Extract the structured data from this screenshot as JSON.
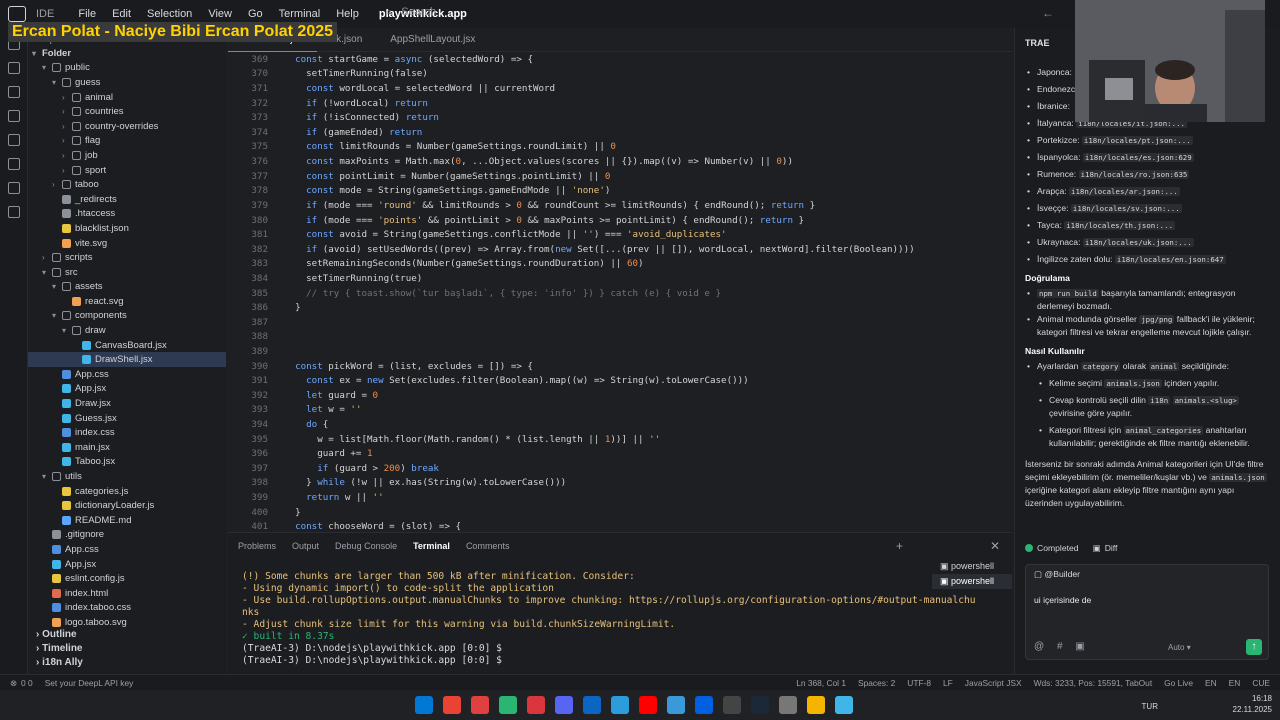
{
  "overlay_text": "Ercan Polat - Naciye Bibi Ercan Polat 2025",
  "titlebar": {
    "ide_label": "IDE",
    "menu": [
      "File",
      "Edit",
      "Selection",
      "View",
      "Go",
      "Terminal",
      "Help"
    ],
    "project": "playwithkick.app",
    "search_placeholder": "Search"
  },
  "explorer": {
    "title": "Explorer",
    "folder": "Folder",
    "rows": [
      {
        "label": "public",
        "indent": 0,
        "type": "folder",
        "open": true
      },
      {
        "label": "guess",
        "indent": 1,
        "type": "folder",
        "open": true
      },
      {
        "label": "animal",
        "indent": 2,
        "type": "folder",
        "open": false
      },
      {
        "label": "countries",
        "indent": 2,
        "type": "folder",
        "open": false
      },
      {
        "label": "country-overrides",
        "indent": 2,
        "type": "folder",
        "open": false
      },
      {
        "label": "flag",
        "indent": 2,
        "type": "folder",
        "open": false
      },
      {
        "label": "job",
        "indent": 2,
        "type": "folder",
        "open": false
      },
      {
        "label": "sport",
        "indent": 2,
        "type": "folder",
        "open": false
      },
      {
        "label": "taboo",
        "indent": 1,
        "type": "folder",
        "open": false
      },
      {
        "label": "_redirects",
        "indent": 1,
        "type": "file"
      },
      {
        "label": ".htaccess",
        "indent": 1,
        "type": "file"
      },
      {
        "label": "blacklist.json",
        "indent": 1,
        "type": "file"
      },
      {
        "label": "vite.svg",
        "indent": 1,
        "type": "file"
      },
      {
        "label": "scripts",
        "indent": 0,
        "type": "folder",
        "open": false
      },
      {
        "label": "src",
        "indent": 0,
        "type": "folder",
        "open": true
      },
      {
        "label": "assets",
        "indent": 1,
        "type": "folder",
        "open": true
      },
      {
        "label": "react.svg",
        "indent": 2,
        "type": "file"
      },
      {
        "label": "components",
        "indent": 1,
        "type": "folder",
        "open": true
      },
      {
        "label": "draw",
        "indent": 2,
        "type": "folder",
        "open": true
      },
      {
        "label": "CanvasBoard.jsx",
        "indent": 3,
        "type": "file"
      },
      {
        "label": "DrawShell.jsx",
        "indent": 3,
        "type": "file",
        "selected": true
      },
      {
        "label": "App.css",
        "indent": 1,
        "type": "file"
      },
      {
        "label": "App.jsx",
        "indent": 1,
        "type": "file"
      },
      {
        "label": "Draw.jsx",
        "indent": 1,
        "type": "file"
      },
      {
        "label": "Guess.jsx",
        "indent": 1,
        "type": "file"
      },
      {
        "label": "index.css",
        "indent": 1,
        "type": "file"
      },
      {
        "label": "main.jsx",
        "indent": 1,
        "type": "file"
      },
      {
        "label": "Taboo.jsx",
        "indent": 1,
        "type": "file"
      },
      {
        "label": "utils",
        "indent": 0,
        "type": "folder",
        "open": true
      },
      {
        "label": "categories.js",
        "indent": 1,
        "type": "file"
      },
      {
        "label": "dictionaryLoader.js",
        "indent": 1,
        "type": "file"
      },
      {
        "label": "README.md",
        "indent": 1,
        "type": "file"
      },
      {
        "label": ".gitignore",
        "indent": 0,
        "type": "file"
      },
      {
        "label": "App.css",
        "indent": 0,
        "type": "file"
      },
      {
        "label": "App.jsx",
        "indent": 0,
        "type": "file"
      },
      {
        "label": "eslint.config.js",
        "indent": 0,
        "type": "file"
      },
      {
        "label": "index.html",
        "indent": 0,
        "type": "file"
      },
      {
        "label": "index.taboo.css",
        "indent": 0,
        "type": "file"
      },
      {
        "label": "logo.taboo.svg",
        "indent": 0,
        "type": "file"
      }
    ],
    "outline": "Outline",
    "timeline": "Timeline",
    "i18n": "i18n Ally"
  },
  "editor": {
    "tabs": [
      "DrawShell.jsx",
      "uk.json",
      "AppShellLayout.jsx"
    ],
    "lines": [
      {
        "n": "369",
        "t": "  const startGame = async (selectedWord) => {"
      },
      {
        "n": "370",
        "t": "    setTimerRunning(false)"
      },
      {
        "n": "371",
        "t": "    const wordLocal = selectedWord || currentWord"
      },
      {
        "n": "372",
        "t": "    if (!wordLocal) return"
      },
      {
        "n": "373",
        "t": "    if (!isConnected) return"
      },
      {
        "n": "374",
        "t": "    if (gameEnded) return"
      },
      {
        "n": "375",
        "t": "    const limitRounds = Number(gameSettings.roundLimit) || 0"
      },
      {
        "n": "376",
        "t": "    const maxPoints = Math.max(0, ...Object.values(scores || {}).map((v) => Number(v) || 0))"
      },
      {
        "n": "377",
        "t": "    const pointLimit = Number(gameSettings.pointLimit) || 0"
      },
      {
        "n": "378",
        "t": "    const mode = String(gameSettings.gameEndMode || 'none')"
      },
      {
        "n": "379",
        "t": "    if (mode === 'round' && limitRounds > 0 && roundCount >= limitRounds) { endRound(); return }"
      },
      {
        "n": "380",
        "t": "    if (mode === 'points' && pointLimit > 0 && maxPoints >= pointLimit) { endRound(); return }"
      },
      {
        "n": "381",
        "t": "    const avoid = String(gameSettings.conflictMode || '') === 'avoid_duplicates'"
      },
      {
        "n": "382",
        "t": "    if (avoid) setUsedWords((prev) => Array.from(new Set([...(prev || []), wordLocal, nextWord].filter(Boolean))))"
      },
      {
        "n": "383",
        "t": "    setRemainingSeconds(Number(gameSettings.roundDuration) || 60)"
      },
      {
        "n": "384",
        "t": "    setTimerRunning(true)"
      },
      {
        "n": "385",
        "t": "    // try { toast.show(`tur başladı`, { type: 'info' }) } catch (e) { void e }"
      },
      {
        "n": "386",
        "t": "  }"
      },
      {
        "n": "387",
        "t": ""
      },
      {
        "n": "388",
        "t": ""
      },
      {
        "n": "389",
        "t": ""
      },
      {
        "n": "390",
        "t": "  const pickWord = (list, excludes = []) => {"
      },
      {
        "n": "391",
        "t": "    const ex = new Set(excludes.filter(Boolean).map((w) => String(w).toLowerCase()))"
      },
      {
        "n": "392",
        "t": "    let guard = 0"
      },
      {
        "n": "393",
        "t": "    let w = ''"
      },
      {
        "n": "394",
        "t": "    do {"
      },
      {
        "n": "395",
        "t": "      w = list[Math.floor(Math.random() * (list.length || 1))] || ''"
      },
      {
        "n": "396",
        "t": "      guard += 1"
      },
      {
        "n": "397",
        "t": "      if (guard > 200) break"
      },
      {
        "n": "398",
        "t": "    } while (!w || ex.has(String(w).toLowerCase()))"
      },
      {
        "n": "399",
        "t": "    return w || ''"
      },
      {
        "n": "400",
        "t": "  }"
      },
      {
        "n": "401",
        "t": "  const chooseWord = (slot) => {"
      }
    ]
  },
  "panel": {
    "tabs": [
      "Problems",
      "Output",
      "Debug Console",
      "Terminal",
      "Comments"
    ],
    "active_tab": "Terminal",
    "terminal_lines": [
      {
        "t": "(!) Some chunks are larger than 500 kB after minification. Consider:",
        "c": "#e5c07b"
      },
      {
        "t": "- Using dynamic import() to code-split the application",
        "c": "#e5c07b"
      },
      {
        "t": "- Use build.rollupOptions.output.manualChunks to improve chunking: https://rollupjs.org/configuration-options/#output-manualchu",
        "c": "#e5c07b"
      },
      {
        "t": "nks",
        "c": "#e5c07b"
      },
      {
        "t": "- Adjust chunk size limit for this warning via build.chunkSizeWarningLimit.",
        "c": "#e5c07b"
      },
      {
        "t": "✓ built in 8.37s",
        "c": "#2ab573"
      },
      {
        "t": "(TraeAI-3) D:\\nodejs\\playwithkick.app [0:0] $",
        "c": "#d6d9de"
      },
      {
        "t": "(TraeAI-3) D:\\nodejs\\playwithkick.app [0:0] $",
        "c": "#d6d9de"
      }
    ],
    "terminals": [
      "powershell",
      "powershell"
    ]
  },
  "side": {
    "title": "TRAE",
    "langs": [
      {
        "label": "Japonca:",
        "code": ""
      },
      {
        "label": "Endonezce:",
        "code": ""
      },
      {
        "label": "İbranice:",
        "code": ""
      },
      {
        "label": "İtalyanca:",
        "code": "i18n/locales/it.json:..."
      },
      {
        "label": "Portekizce:",
        "code": "i18n/locales/pt.json:..."
      },
      {
        "label": "İspanyolca:",
        "code": "i18n/locales/es.json:629"
      },
      {
        "label": "Rumence:",
        "code": "i18n/locales/ro.json:635"
      },
      {
        "label": "Arapça:",
        "code": "i18n/locales/ar.json:..."
      },
      {
        "label": "İsveççe:",
        "code": "i18n/locales/sv.json:..."
      },
      {
        "label": "Tayca:",
        "code": "i18n/locales/th.json:..."
      },
      {
        "label": "Ukraynaca:",
        "code": "i18n/locales/uk.json:..."
      },
      {
        "label": "İngilizce zaten dolu:",
        "code": "i18n/locales/en.json:647"
      }
    ],
    "h_dogrulama": "Doğrulama",
    "dog1_code": "npm run build",
    "dog1_text": "başarıyla tamamlandı; entegrasyon derlemeyi bozmadı.",
    "dog2_pre": "Animal modunda görseller",
    "dog2_code": "jpg/png",
    "dog2_text": "fallback'i ile yüklenir; kategori filtresi ve tekrar engelleme mevcut lojikle çalışır.",
    "h_nasil": "Nasıl Kullanılır",
    "n1_pre": "Ayarlardan",
    "n1_code1": "category",
    "n1_mid": "olarak",
    "n1_code2": "animal",
    "n1_post": "seçildiğinde:",
    "n2_pre": "Kelime seçimi",
    "n2_code": "animals.json",
    "n2_post": "içinden yapılır.",
    "n3_pre": "Cevap kontrolü seçili dilin",
    "n3_code1": "i18n",
    "n3_code2": "animals.<slug>",
    "n3_post": "çevirisine göre yapılır.",
    "n4_pre": "Kategori filtresi için",
    "n4_code": "animal_categories",
    "n4_post": "anahtarları kullanılabilir; gerektiğinde ek filtre mantığı eklenebilir.",
    "p1": "İsterseniz bir sonraki adımda Animal kategorileri için UI'de filtre seçimi ekleyebilirim (ör. memeliler/kuşlar vb.) ve",
    "p1_code": "animals.json",
    "p1_post": "içeriğine kategori alanı ekleyip filtre mantığını aynı yapı üzerinden uygulayabilirim.",
    "completed": "Completed",
    "diff": "Diff",
    "builder": "@Builder",
    "input_text": "ui içerisinde de",
    "model": "Auto"
  },
  "statusbar": {
    "left": "Set your DeepL API key",
    "left_counts": "0  0",
    "pos": "Ln 368, Col 1",
    "spaces": "Spaces: 2",
    "enc": "UTF-8",
    "eol": "LF",
    "lang": "JavaScript JSX",
    "words": "Wds: 3233, Pos: 15591, TabOut",
    "golive": "Go Live",
    "en1": "EN",
    "en2": "EN",
    "cue": "CUE"
  },
  "taskbar": {
    "lang": "TUR",
    "time": "16:18",
    "date": "22.11.2025"
  }
}
